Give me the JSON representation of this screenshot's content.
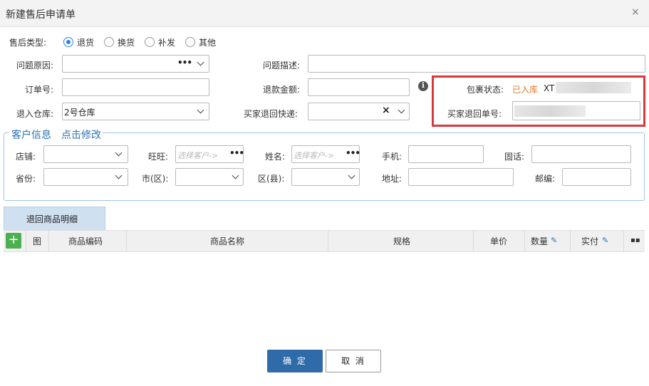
{
  "dialog": {
    "title": "新建售后申请单",
    "close": "×"
  },
  "type_row": {
    "label": "售后类型:",
    "options": [
      "退货",
      "换货",
      "补发",
      "其他"
    ],
    "selected": "退货"
  },
  "form": {
    "reason_label": "问题原因:",
    "desc_label": "问题描述:",
    "order_label": "订单号:",
    "refund_label": "退款金额:",
    "warehouse_label": "退入仓库:",
    "warehouse_value": "2号仓库",
    "express_label": "买家退回快递:",
    "express_clear": "×",
    "info_icon": "i",
    "pkg_status_label": "包裹状态:",
    "pkg_status_value": "已入库",
    "pkg_status_code": "XT",
    "return_no_label": "买家退回单号:"
  },
  "customer": {
    "legend": "客户信息",
    "edit_link": "点击修改",
    "shop_label": "店铺:",
    "wangwang_label": "旺旺:",
    "wangwang_placeholder": "选择客户->",
    "name_label": "姓名:",
    "name_placeholder": "选择客户->",
    "mobile_label": "手机:",
    "phone_label": "固话:",
    "province_label": "省份:",
    "city_label": "市(区):",
    "district_label": "区(县):",
    "address_label": "地址:",
    "zip_label": "邮编:"
  },
  "goods": {
    "tab": "退回商品明细",
    "add": "+",
    "columns": [
      "图",
      "商品编码",
      "商品名称",
      "规格",
      "单价",
      "数量",
      "实付"
    ]
  },
  "footer": {
    "ok": "确 定",
    "cancel": "取 消"
  },
  "colors": {
    "primary": "#2f6aa9",
    "status_orange": "#e07a2f",
    "highlight_red": "#d9383c",
    "add_green": "#4caf50"
  }
}
